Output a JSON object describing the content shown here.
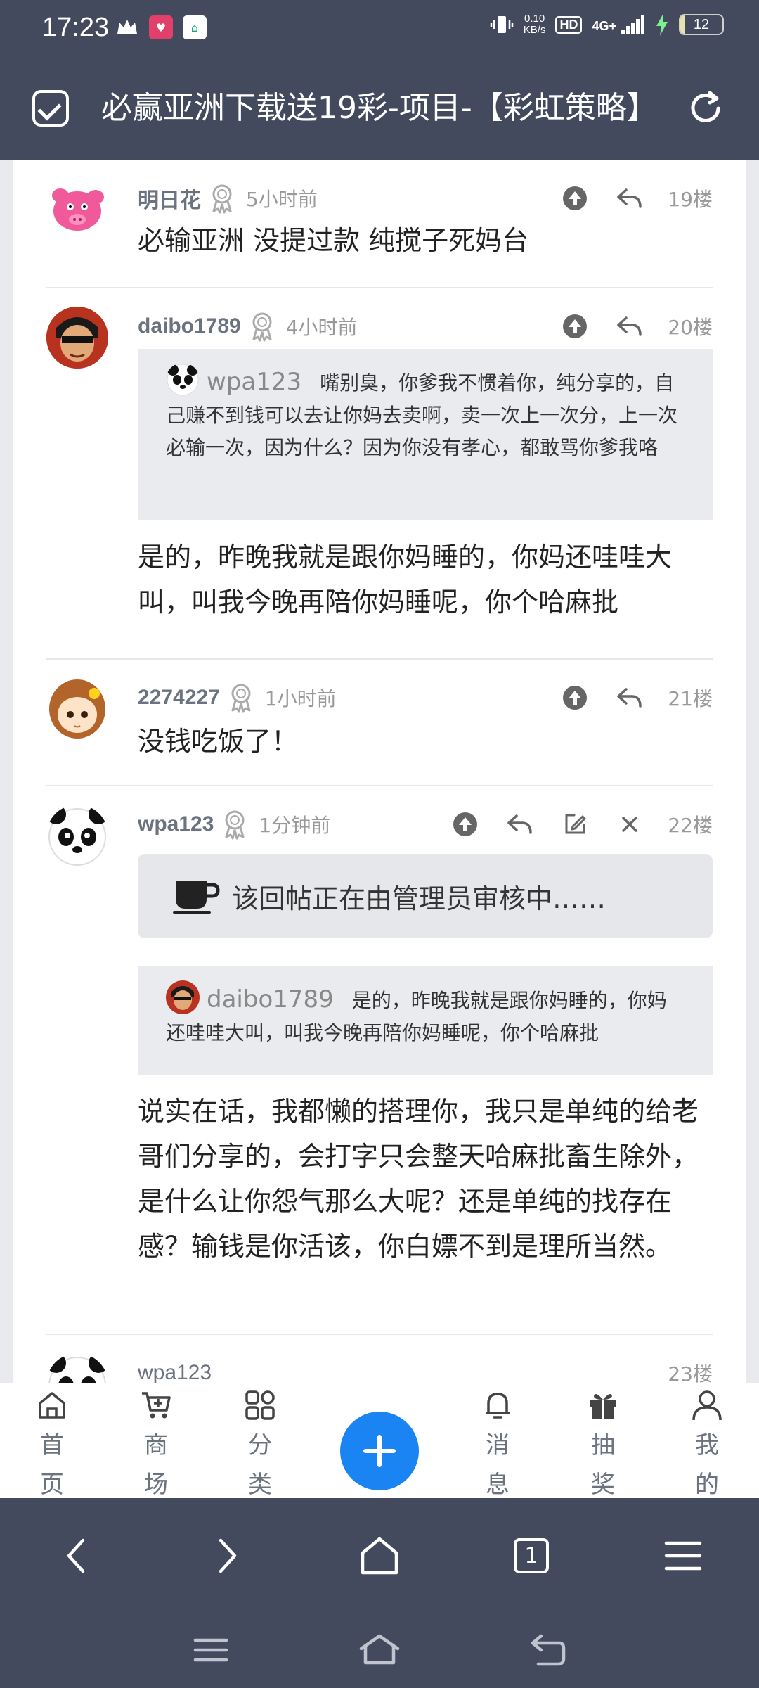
{
  "status_bar": {
    "time": "17:23",
    "net_speed_value": "0.10",
    "net_speed_unit": "KB/s",
    "hd": "HD",
    "network": "4G+",
    "battery_level": "12",
    "battery_fraction": 0.12
  },
  "title_bar": {
    "title": "必赢亚洲下载送19彩-项目-【彩虹策略】"
  },
  "posts": [
    {
      "username": "明日花",
      "time": "5小时前",
      "floor": "19楼",
      "body": "必输亚洲 没提过款 纯搅子死妈台"
    },
    {
      "username": "daibo1789",
      "time": "4小时前",
      "floor": "20楼",
      "quote_user": "wpa123",
      "quote_text": "嘴别臭，你爹我不惯着你，纯分享的，自己赚不到钱可以去让你妈去卖啊，卖一次上一次分，上一次必输一次，因为什么？因为你没有孝心，都敢骂你爹我咯",
      "body": "是的，昨晚我就是跟你妈睡的，你妈还哇哇大叫，叫我今晚再陪你妈睡呢，你个哈麻批"
    },
    {
      "username": "2274227",
      "time": "1小时前",
      "floor": "21楼",
      "body": "没钱吃饭了！"
    },
    {
      "username": "wpa123",
      "time": "1分钟前",
      "floor": "22楼",
      "pending": "该回帖正在由管理员审核中……",
      "quote_user": "daibo1789",
      "quote_text": "是的，昨晚我就是跟你妈睡的，你妈还哇哇大叫，叫我今晚再陪你妈睡呢，你个哈麻批",
      "body": "说实在话，我都懒的搭理你，我只是单纯的给老哥们分享的，会打字只会整天哈麻批畜生除外，是什么让你怨气那么大呢？还是单纯的找存在感？输钱是你活该，你白嫖不到是理所当然。"
    },
    {
      "username": "wpa123",
      "floor": "23楼"
    }
  ],
  "bottom_nav": {
    "home": "首页",
    "shop": "商场",
    "category": "分类",
    "messages": "消息",
    "lottery": "抽奖",
    "mine": "我的"
  },
  "browser_bar": {
    "tab_count": "1"
  },
  "colors": {
    "header_bg": "#444a5e",
    "accent": "#1a84f2",
    "quote_bg": "#e9ebee"
  }
}
